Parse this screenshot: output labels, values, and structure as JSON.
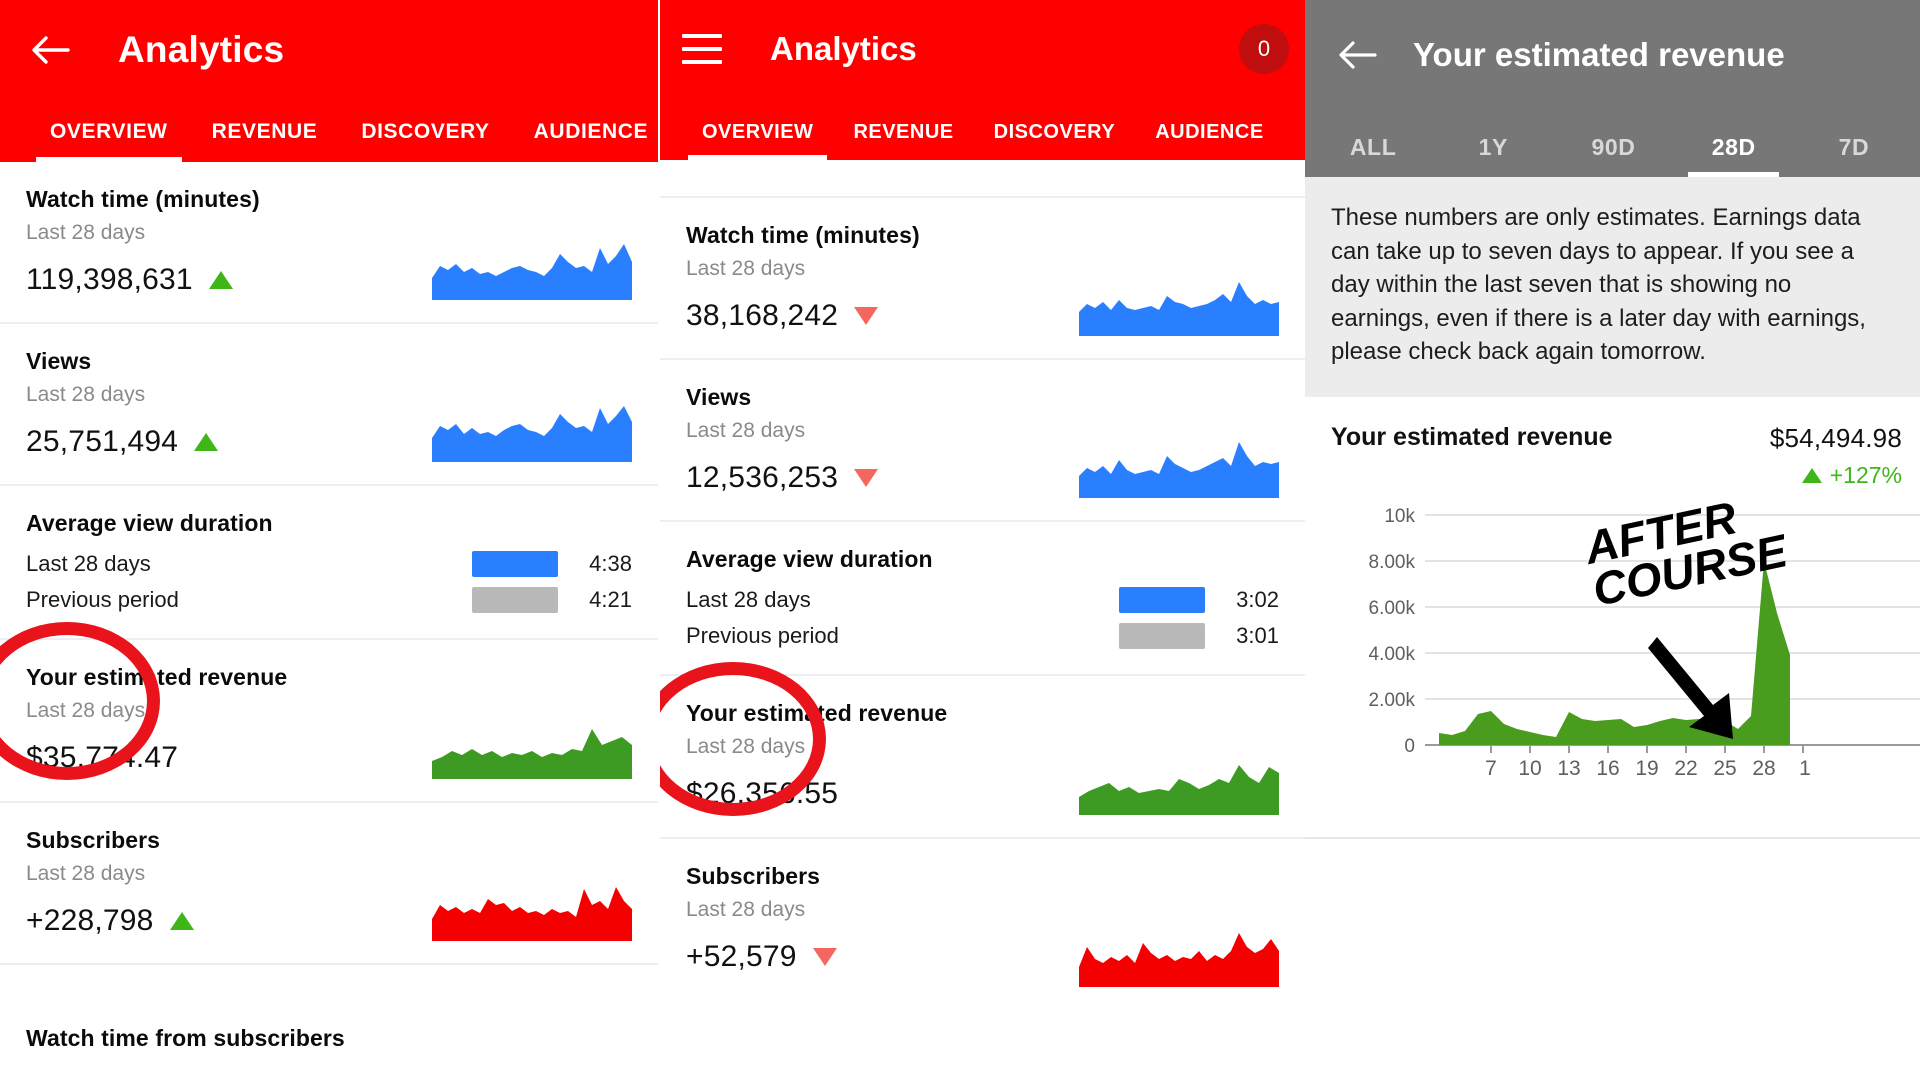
{
  "panel1": {
    "appbar": {
      "back_icon": "back-arrow-icon",
      "title": "Analytics",
      "tabs": [
        {
          "label": "OVERVIEW",
          "active": true
        },
        {
          "label": "REVENUE",
          "active": false
        },
        {
          "label": "DISCOVERY",
          "active": false
        },
        {
          "label": "AUDIENCE",
          "active": false
        }
      ]
    },
    "cards": [
      {
        "title": "Watch time (minutes)",
        "subtitle": "Last 28 days",
        "value": "119,398,631",
        "trend": "up",
        "spark_color": "#2a7fff"
      },
      {
        "title": "Views",
        "subtitle": "Last 28 days",
        "value": "25,751,494",
        "trend": "up",
        "spark_color": "#2a7fff"
      },
      {
        "title": "Average view duration",
        "rows": [
          {
            "label": "Last 28 days",
            "time": "4:38",
            "bar": "blue"
          },
          {
            "label": "Previous period",
            "time": "4:21",
            "bar": "gray"
          }
        ]
      },
      {
        "title": "Your estimated revenue",
        "subtitle": "Last 28 days",
        "value": "$35,774.47",
        "trend": "none",
        "spark_color": "#3d9b23",
        "circled": true
      },
      {
        "title": "Subscribers",
        "subtitle": "Last 28 days",
        "value": "+228,798",
        "trend": "up",
        "spark_color": "#f40000"
      },
      {
        "title": "Watch time from subscribers"
      }
    ]
  },
  "panel2": {
    "appbar": {
      "menu_icon": "hamburger-menu-icon",
      "title": "Analytics",
      "badge_count": "0",
      "tabs": [
        {
          "label": "OVERVIEW",
          "active": true
        },
        {
          "label": "REVENUE",
          "active": false
        },
        {
          "label": "DISCOVERY",
          "active": false
        },
        {
          "label": "AUDIENCE",
          "active": false
        }
      ]
    },
    "cards": [
      {
        "title": "Watch time (minutes)",
        "subtitle": "Last 28 days",
        "value": "38,168,242",
        "trend": "down",
        "spark_color": "#2a7fff"
      },
      {
        "title": "Views",
        "subtitle": "Last 28 days",
        "value": "12,536,253",
        "trend": "down",
        "spark_color": "#2a7fff"
      },
      {
        "title": "Average view duration",
        "rows": [
          {
            "label": "Last 28 days",
            "time": "3:02",
            "bar": "blue"
          },
          {
            "label": "Previous period",
            "time": "3:01",
            "bar": "gray"
          }
        ]
      },
      {
        "title": "Your estimated revenue",
        "subtitle": "Last 28 days",
        "value": "$26,356.55",
        "trend": "none",
        "spark_color": "#3d9b23",
        "circled": true
      },
      {
        "title": "Subscribers",
        "subtitle": "Last 28 days",
        "value": "+52,579",
        "trend": "down",
        "spark_color": "#f40000"
      }
    ]
  },
  "panel3": {
    "appbar": {
      "back_icon": "back-arrow-icon",
      "title": "Your estimated revenue",
      "tabs": [
        {
          "label": "ALL",
          "active": false
        },
        {
          "label": "1Y",
          "active": false
        },
        {
          "label": "90D",
          "active": false
        },
        {
          "label": "28D",
          "active": true
        },
        {
          "label": "7D",
          "active": false
        }
      ]
    },
    "note": "These numbers are only estimates. Earnings data can take up to seven days to appear. If you see a day within the last seven that is showing no earnings, even if there is a later day with earnings, please check back again tomorrow.",
    "revenue_label": "Your estimated revenue",
    "revenue_value": "$54,494.98",
    "revenue_delta": "+127%",
    "revenue_delta_direction": "up",
    "annotation": {
      "line1": "AFTER",
      "line2": "COURSE",
      "arrow": "down-right-arrow-icon"
    }
  },
  "colors": {
    "brand_red": "#ff0000",
    "trend_up_green": "#3fb618",
    "trend_down_red": "#f4675f",
    "series_blue": "#2a7fff",
    "series_green": "#3d9b23",
    "series_red": "#f40000",
    "highlight_circle": "#e8131b",
    "panel3_appbar_gray": "#777777"
  },
  "chart_data": {
    "type": "area",
    "title": "Your estimated revenue",
    "xlabel": "",
    "ylabel": "",
    "ylim": [
      0,
      10000
    ],
    "yticks": [
      0,
      2000,
      4000,
      6000,
      8000,
      10000
    ],
    "ytick_labels": [
      "0",
      "2.00k",
      "4.00k",
      "6.00k",
      "8.00k",
      "10k"
    ],
    "xticks": [
      7,
      10,
      13,
      16,
      19,
      22,
      25,
      28,
      1
    ],
    "xtick_labels": [
      "7",
      "10",
      "13",
      "16",
      "19",
      "22",
      "25",
      "28",
      "1"
    ],
    "grid": true,
    "legend": "none",
    "series": [
      {
        "name": "Estimated revenue",
        "color": "#3d9b23",
        "x": [
          4,
          5,
          6,
          7,
          8,
          9,
          10,
          11,
          12,
          13,
          14,
          15,
          16,
          17,
          18,
          19,
          20,
          21,
          22,
          23,
          24,
          25,
          26,
          27,
          28,
          29,
          30,
          31
        ],
        "values": [
          480,
          430,
          560,
          1320,
          1400,
          900,
          700,
          560,
          420,
          380,
          1150,
          950,
          880,
          900,
          930,
          700,
          780,
          880,
          1000,
          920,
          950,
          960,
          900,
          730,
          1160,
          9200,
          6200,
          3900
        ]
      }
    ],
    "annotations": [
      {
        "text": "AFTER COURSE",
        "points_to_x": 26,
        "points_to_y": 1200
      }
    ]
  }
}
